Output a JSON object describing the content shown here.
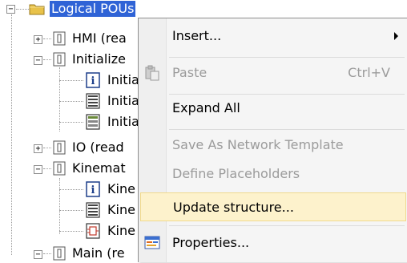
{
  "tree": {
    "root": {
      "label": "Logical POUs"
    },
    "items": [
      {
        "label": "HMI (rea",
        "expander": "+"
      },
      {
        "label": "Initialize",
        "expander": "−"
      },
      {
        "label": "Initia"
      },
      {
        "label": "Initia"
      },
      {
        "label": "Initia"
      },
      {
        "label": "IO (read",
        "expander": "+"
      },
      {
        "label": "Kinemat",
        "expander": "−"
      },
      {
        "label": "Kine"
      },
      {
        "label": "Kine"
      },
      {
        "label": "Kine"
      },
      {
        "label": "Main (re",
        "expander": "−"
      }
    ],
    "colors": {
      "selection": "#2f63d6",
      "folder": "#e8c24a"
    }
  },
  "context_menu": {
    "items": [
      {
        "label": "Insert...",
        "has_submenu": true,
        "enabled": true
      },
      {
        "label": "Paste",
        "shortcut": "Ctrl+V",
        "enabled": false,
        "icon": "paste-icon"
      },
      {
        "label": "Expand All",
        "enabled": true
      },
      {
        "label": "Save As Network Template",
        "enabled": false
      },
      {
        "label": "Define Placeholders",
        "enabled": false
      },
      {
        "label": "Update structure...",
        "enabled": true,
        "highlighted": true
      },
      {
        "label": "Properties...",
        "enabled": true,
        "icon": "properties-icon"
      }
    ],
    "colors": {
      "highlight": "#fdf2cc",
      "disabled_text": "#9b9b9b"
    }
  }
}
